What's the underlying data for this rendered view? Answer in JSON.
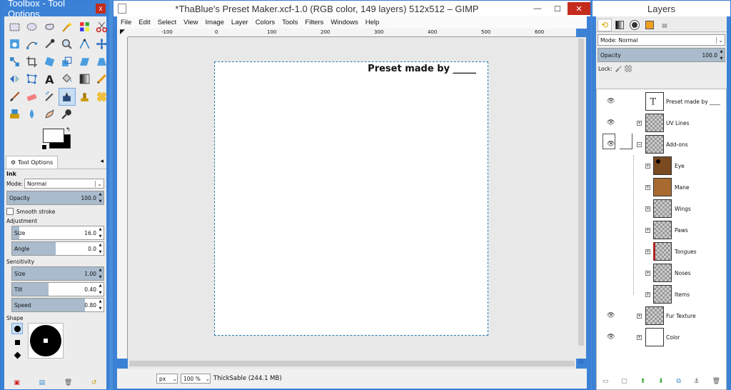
{
  "toolbox": {
    "title": "Toolbox - Tool Options",
    "close": "x",
    "tab_label": "Tool Options",
    "tool_name": "Ink",
    "mode_label": "Mode:",
    "mode_value": "Normal",
    "opacity_label": "Opacity",
    "opacity_value": "100.0",
    "smooth_label": "Smooth stroke",
    "adjustment_label": "Adjustment",
    "adj_size_label": "Size",
    "adj_size_value": "16.0",
    "angle_label": "Angle",
    "angle_value": "0.0",
    "sensitivity_label": "Sensitivity",
    "sens_size_label": "Size",
    "sens_size_value": "1.00",
    "tilt_label": "Tilt",
    "tilt_value": "0.40",
    "speed_label": "Speed",
    "speed_value": "0.80",
    "shape_label": "Shape"
  },
  "image_window": {
    "title": "*ThaBlue's Preset Maker.xcf-1.0 (RGB color, 149 layers) 512x512 – GIMP",
    "menu": [
      "File",
      "Edit",
      "Select",
      "View",
      "Image",
      "Layer",
      "Colors",
      "Tools",
      "Filters",
      "Windows",
      "Help"
    ],
    "ruler_labels": [
      "-100",
      "0",
      "100",
      "200",
      "300",
      "400",
      "500",
      "600"
    ],
    "canvas_text": "Preset made by _____",
    "unit": "px",
    "zoom": "100 %",
    "status": "ThickSable (244.1 MB)"
  },
  "layers": {
    "title": "Layers",
    "mode_label": "Mode: Normal",
    "opacity_label": "Opacity",
    "opacity_value": "100.0",
    "lock_label": "Lock:",
    "items": [
      {
        "name": "Preset made by ____"
      },
      {
        "name": "UV Lines"
      },
      {
        "name": "Add-ons"
      },
      {
        "name": "Eye"
      },
      {
        "name": "Mane"
      },
      {
        "name": "Wings"
      },
      {
        "name": "Paws"
      },
      {
        "name": "Tongues"
      },
      {
        "name": "Noses"
      },
      {
        "name": "Items"
      },
      {
        "name": "Fur Texture"
      },
      {
        "name": "Color"
      }
    ]
  },
  "colors": {
    "selection": "#2a7aa8",
    "accent": "#3b82d6"
  }
}
